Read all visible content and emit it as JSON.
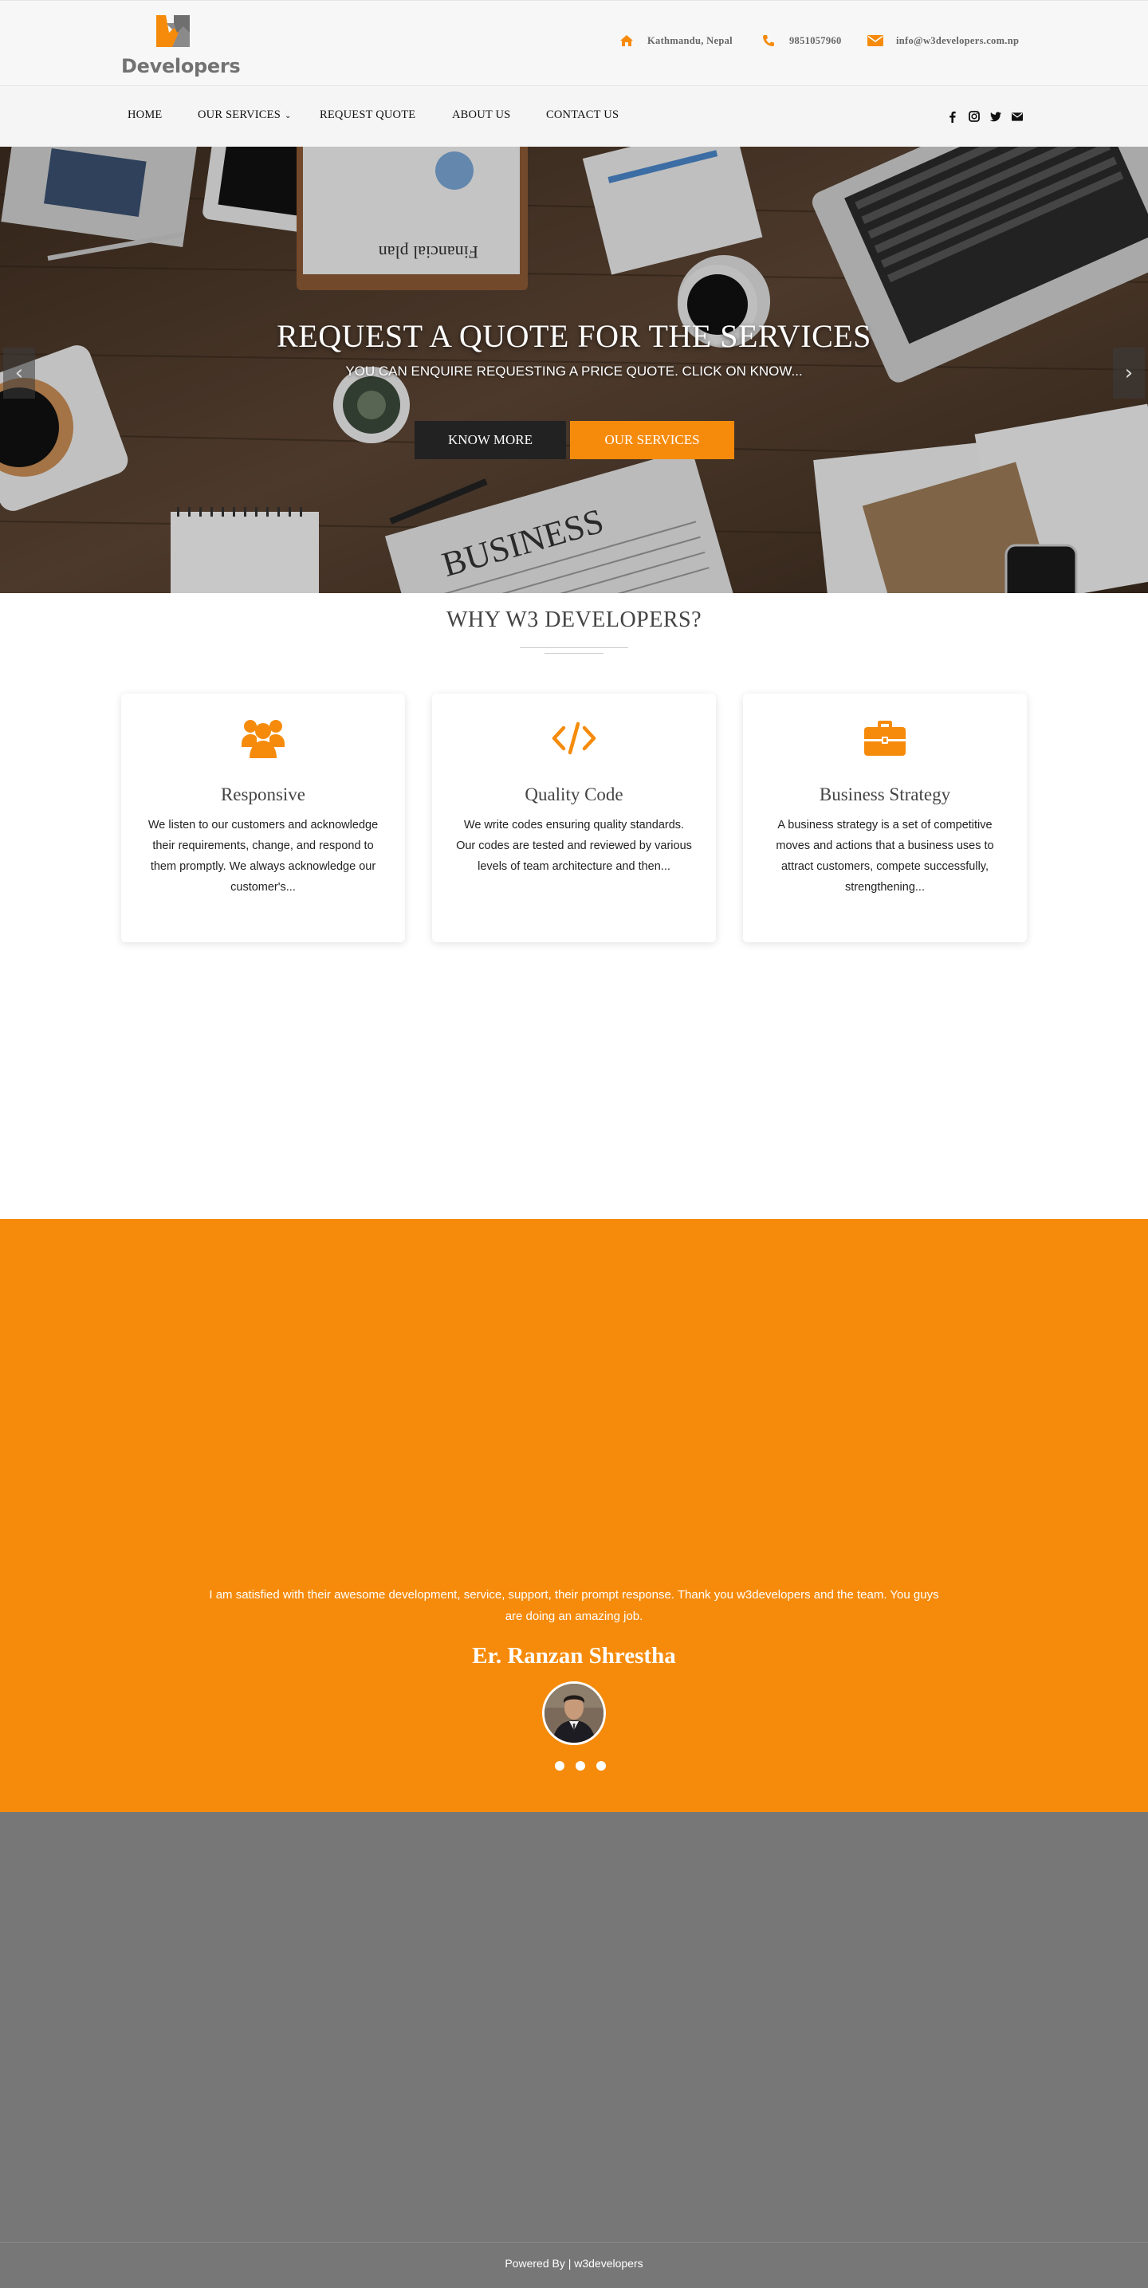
{
  "brand": {
    "logo_text": "Developers",
    "accent": "#f68b0b"
  },
  "header": {
    "location": "Kathmandu, Nepal",
    "phone": "9851057960",
    "email": "info@w3developers.com.np",
    "icons": [
      "home-icon",
      "phone-icon",
      "envelope-icon"
    ]
  },
  "nav": {
    "items": [
      "HOME",
      "OUR SERVICES",
      "REQUEST QUOTE",
      "ABOUT US",
      "CONTACT US"
    ],
    "social": [
      "facebook-icon",
      "instagram-icon",
      "twitter-icon",
      "envelope-icon"
    ]
  },
  "hero": {
    "title": "REQUEST A QUOTE FOR THE SERVICES",
    "subtitle": "YOU CAN ENQUIRE REQUESTING A PRICE QUOTE. CLICK ON KNOW...",
    "btn_primary": "KNOW MORE",
    "btn_secondary": "OUR SERVICES"
  },
  "why": {
    "title": "WHY W3 DEVELOPERS?",
    "cards": [
      {
        "icon": "users-icon",
        "title": "Responsive",
        "desc": "We listen to our customers and acknowledge their requirements, change, and respond to them promptly. We always acknowledge our customer's..."
      },
      {
        "icon": "code-icon",
        "title": "Quality Code",
        "desc": "We write codes ensuring quality standards. Our codes are tested and reviewed by various levels of team architecture and then..."
      },
      {
        "icon": "briefcase-icon",
        "title": "Business Strategy",
        "desc": "A business strategy is a set of competitive moves and actions that a business uses to attract customers, compete successfully, strengthening..."
      }
    ]
  },
  "testimonial": {
    "quote": "I am satisfied with their awesome development, service, support, their prompt response. Thank you w3developers and the team. You guys are doing an amazing job.",
    "name": "Er. Ranzan Shrestha"
  },
  "footer": {
    "text": "Powered By | w3developers"
  }
}
